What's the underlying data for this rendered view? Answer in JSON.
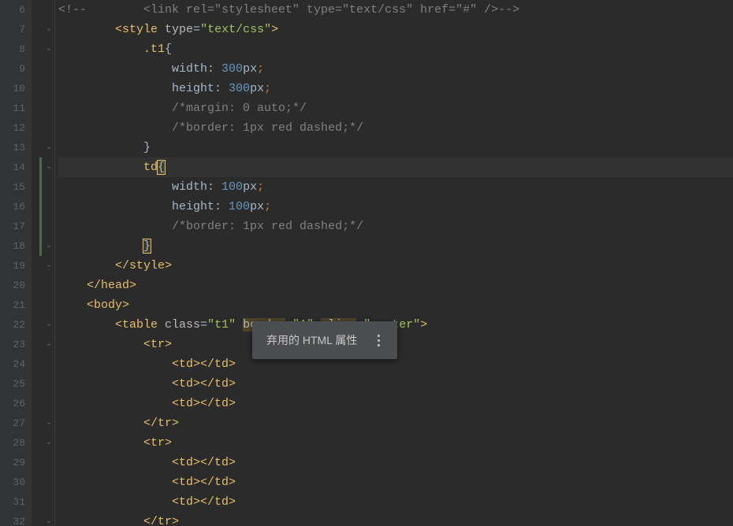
{
  "tooltip": {
    "text": "弃用的 HTML 属性"
  },
  "lines": [
    {
      "n": 6,
      "cls": "",
      "html": "<span class='comment'>&lt;!--        &lt;link rel=\"stylesheet\" type=\"text/css\" href=\"#\" /&gt;--&gt;</span>"
    },
    {
      "n": 7,
      "cls": "",
      "html": "        <span class='tag'>&lt;style </span><span class='attr'>type</span><span class='plain'>=</span><span class='str'>\"text/css\"</span><span class='tag'>&gt;</span>"
    },
    {
      "n": 8,
      "cls": "",
      "html": "            <span class='sel'>.t1</span><span class='brace'>{</span>"
    },
    {
      "n": 9,
      "cls": "",
      "html": "                <span class='prop'>width: </span><span class='num'>300</span><span class='plain'>px</span><span class='punc'>;</span>"
    },
    {
      "n": 10,
      "cls": "",
      "html": "                <span class='prop'>height: </span><span class='num'>300</span><span class='plain'>px</span><span class='punc'>;</span>"
    },
    {
      "n": 11,
      "cls": "",
      "html": "                <span class='comment'>/*margin: 0 auto;*/</span>"
    },
    {
      "n": 12,
      "cls": "",
      "html": "                <span class='comment'>/*border: 1px red dashed;*/</span>"
    },
    {
      "n": 13,
      "cls": "",
      "html": "            <span class='brace'>}</span>"
    },
    {
      "n": 14,
      "cls": "current",
      "html": "            <span class='sel'>td</span><span class='brace cursor-brace'>{</span>"
    },
    {
      "n": 15,
      "cls": "mod",
      "html": "                <span class='prop'>width: </span><span class='num'>100</span><span class='plain'>px</span><span class='punc'>;</span>"
    },
    {
      "n": 16,
      "cls": "mod",
      "html": "                <span class='prop'>height: </span><span class='num'>100</span><span class='plain'>px</span><span class='punc'>;</span>"
    },
    {
      "n": 17,
      "cls": "mod",
      "html": "                <span class='comment'>/*border: 1px red dashed;*/</span>"
    },
    {
      "n": 18,
      "cls": "mod",
      "html": "            <span class='brace cursor-brace'>}</span>"
    },
    {
      "n": 19,
      "cls": "",
      "html": "        <span class='tag'>&lt;/style&gt;</span>"
    },
    {
      "n": 20,
      "cls": "",
      "html": "    <span class='tag'>&lt;/head&gt;</span>"
    },
    {
      "n": 21,
      "cls": "",
      "html": "    <span class='tag'>&lt;body&gt;</span>"
    },
    {
      "n": 22,
      "cls": "",
      "html": "        <span class='tag'>&lt;table </span><span class='attr'>class</span><span class='plain'>=</span><span class='str'>\"t1\"</span><span class='plain'> </span><span class='attr warnbg'>border</span><span class='plain'>=</span><span class='str'>\"1\"</span><span class='plain'> </span><span class='attr warnbg'>align</span><span class='plain'>=</span><span class='str'>\"center\"</span><span class='tag'>&gt;</span>"
    },
    {
      "n": 23,
      "cls": "",
      "html": "            <span class='tag'>&lt;tr&gt;</span>"
    },
    {
      "n": 24,
      "cls": "",
      "html": "                <span class='tag'>&lt;td&gt;&lt;/td&gt;</span>"
    },
    {
      "n": 25,
      "cls": "",
      "html": "                <span class='tag'>&lt;td&gt;&lt;/td&gt;</span>"
    },
    {
      "n": 26,
      "cls": "",
      "html": "                <span class='tag'>&lt;td&gt;&lt;/td&gt;</span>"
    },
    {
      "n": 27,
      "cls": "",
      "html": "            <span class='tag'>&lt;/tr&gt;</span>"
    },
    {
      "n": 28,
      "cls": "",
      "html": "            <span class='tag'>&lt;tr&gt;</span>"
    },
    {
      "n": 29,
      "cls": "",
      "html": "                <span class='tag'>&lt;td&gt;&lt;/td&gt;</span>"
    },
    {
      "n": 30,
      "cls": "",
      "html": "                <span class='tag'>&lt;td&gt;&lt;/td&gt;</span>"
    },
    {
      "n": 31,
      "cls": "",
      "html": "                <span class='tag'>&lt;td&gt;&lt;/td&gt;</span>"
    },
    {
      "n": 32,
      "cls": "",
      "html": "            <span class='tag'>&lt;/tr&gt;</span>"
    }
  ]
}
